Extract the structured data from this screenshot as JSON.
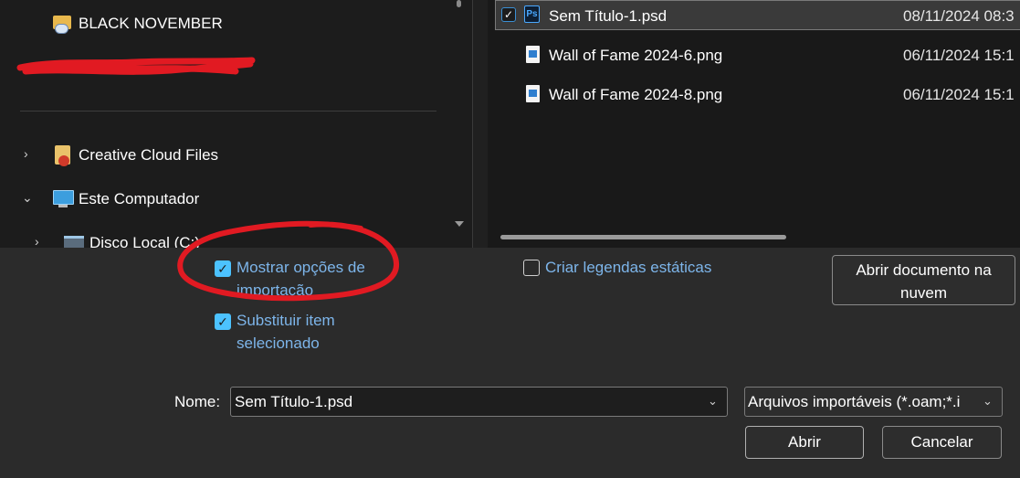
{
  "navigation": {
    "pinned_folder": "BLACK NOVEMBER",
    "items": [
      {
        "label": "Creative Cloud Files",
        "expanded": false
      },
      {
        "label": "Este Computador",
        "expanded": true
      },
      {
        "label": "Disco Local (C:)",
        "expanded": false
      }
    ]
  },
  "files": [
    {
      "name": "Sem Título-1.psd",
      "date": "08/11/2024 08:3",
      "type": "psd",
      "selected": true
    },
    {
      "name": "Wall of Fame 2024-6.png",
      "date": "06/11/2024 15:1",
      "type": "png",
      "selected": false
    },
    {
      "name": "Wall of Fame 2024-8.png",
      "date": "06/11/2024 15:1",
      "type": "png",
      "selected": false
    }
  ],
  "options": {
    "show_import_options": {
      "label": "Mostrar opções de importação",
      "checked": true
    },
    "replace_selected": {
      "label": "Substituir item selecionado",
      "checked": true
    },
    "create_static_captions": {
      "label": "Criar legendas estáticas",
      "checked": false
    }
  },
  "buttons": {
    "open_cloud_document": "Abrir documento na nuvem",
    "open": "Abrir",
    "cancel": "Cancelar"
  },
  "filename": {
    "label": "Nome:",
    "value": "Sem Título-1.psd"
  },
  "file_type": {
    "value": "Arquivos importáveis (*.oam;*.i"
  },
  "icons": {
    "ps_glyph": "Ps",
    "check_glyph": "✓",
    "chevron_right": "›",
    "chevron_down": "⌄"
  },
  "colors": {
    "accent": "#4cc2ff",
    "option_text": "#7db5ea",
    "annotation": "#e11a22",
    "redaction": "#e11a22"
  }
}
